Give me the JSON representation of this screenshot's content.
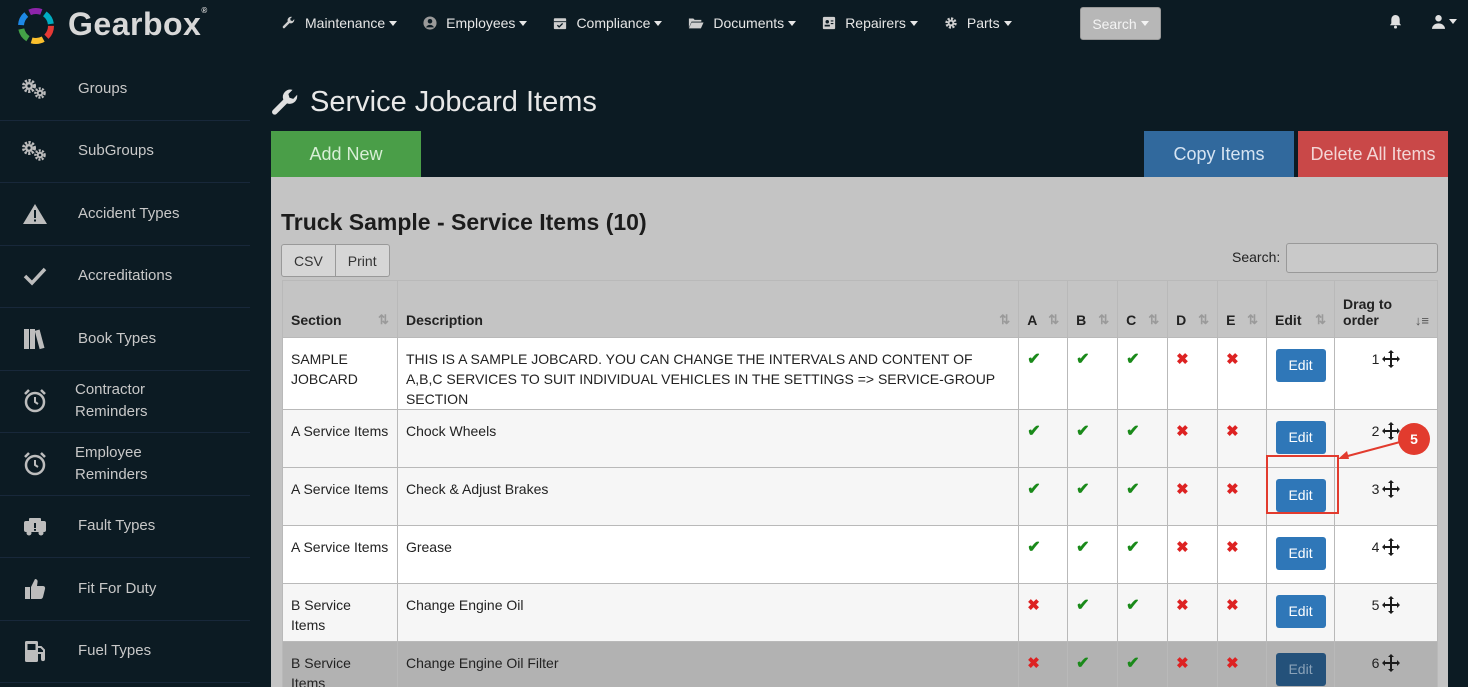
{
  "app": {
    "brand": "Gearbox",
    "trademark": "®"
  },
  "nav": [
    {
      "label": "Maintenance",
      "icon": "wrench-icon"
    },
    {
      "label": "Employees",
      "icon": "user-circle-icon"
    },
    {
      "label": "Compliance",
      "icon": "calendar-check-icon"
    },
    {
      "label": "Documents",
      "icon": "folder-open-icon"
    },
    {
      "label": "Repairers",
      "icon": "address-card-icon"
    },
    {
      "label": "Parts",
      "icon": "gear-icon"
    }
  ],
  "search_button": "Search",
  "sidebar": [
    {
      "label": "Groups",
      "icon": "gears-icon"
    },
    {
      "label": "SubGroups",
      "icon": "gears-icon"
    },
    {
      "label": "Accident Types",
      "icon": "warning-icon"
    },
    {
      "label": "Accreditations",
      "icon": "check-icon"
    },
    {
      "label": "Book Types",
      "icon": "books-icon"
    },
    {
      "label": "Contractor\nReminders",
      "line1": "Contractor",
      "line2": "Reminders",
      "icon": "alarm-clock-icon"
    },
    {
      "label": "Employee\nReminders",
      "line1": "Employee",
      "line2": "Reminders",
      "icon": "alarm-clock-icon"
    },
    {
      "label": "Fault Types",
      "icon": "car-crash-icon"
    },
    {
      "label": "Fit For Duty",
      "icon": "thumbs-up-icon"
    },
    {
      "label": "Fuel Types",
      "icon": "gas-pump-icon"
    }
  ],
  "page": {
    "title": "Service Jobcard Items",
    "add_new": "Add New",
    "copy_items": "Copy Items",
    "delete_all": "Delete All Items"
  },
  "panel": {
    "title": "Truck Sample - Service Items (10)",
    "csv": "CSV",
    "print": "Print",
    "search_label": "Search:"
  },
  "table": {
    "headers": {
      "section": "Section",
      "description": "Description",
      "a": "A",
      "b": "B",
      "c": "C",
      "d": "D",
      "e": "E",
      "edit": "Edit",
      "drag_line1": "Drag to",
      "drag_line2": "order"
    },
    "rows": [
      {
        "section": "SAMPLE JOBCARD",
        "description": "THIS IS A SAMPLE JOBCARD. YOU CAN CHANGE THE INTERVALS AND CONTENT OF A,B,C SERVICES TO SUIT INDIVIDUAL VEHICLES IN THE SETTINGS => SERVICE-GROUP SECTION",
        "a": true,
        "b": true,
        "c": true,
        "d": false,
        "e": false,
        "edit": "Edit",
        "order": "1"
      },
      {
        "section": "A Service Items",
        "description": "Chock Wheels",
        "a": true,
        "b": true,
        "c": true,
        "d": false,
        "e": false,
        "edit": "Edit",
        "order": "2"
      },
      {
        "section": "A Service Items",
        "description": "Check & Adjust Brakes",
        "a": true,
        "b": true,
        "c": true,
        "d": false,
        "e": false,
        "edit": "Edit",
        "order": "3"
      },
      {
        "section": "A Service Items",
        "description": "Grease",
        "a": true,
        "b": true,
        "c": true,
        "d": false,
        "e": false,
        "edit": "Edit",
        "order": "4"
      },
      {
        "section": "B Service Items",
        "description": "Change Engine Oil",
        "a": false,
        "b": true,
        "c": true,
        "d": false,
        "e": false,
        "edit": "Edit",
        "order": "5"
      },
      {
        "section": "B Service Items",
        "description": "Change Engine Oil Filter",
        "a": false,
        "b": true,
        "c": true,
        "d": false,
        "e": false,
        "edit": "Edit",
        "order": "6"
      }
    ]
  },
  "annotation": {
    "badge": "5",
    "color": "#e23b2e"
  },
  "colors": {
    "add": "#4a9e48",
    "copy": "#31699d",
    "delete": "#c94848",
    "edit": "#2f77b8",
    "check": "#1a8a1a",
    "cross": "#d22222"
  }
}
